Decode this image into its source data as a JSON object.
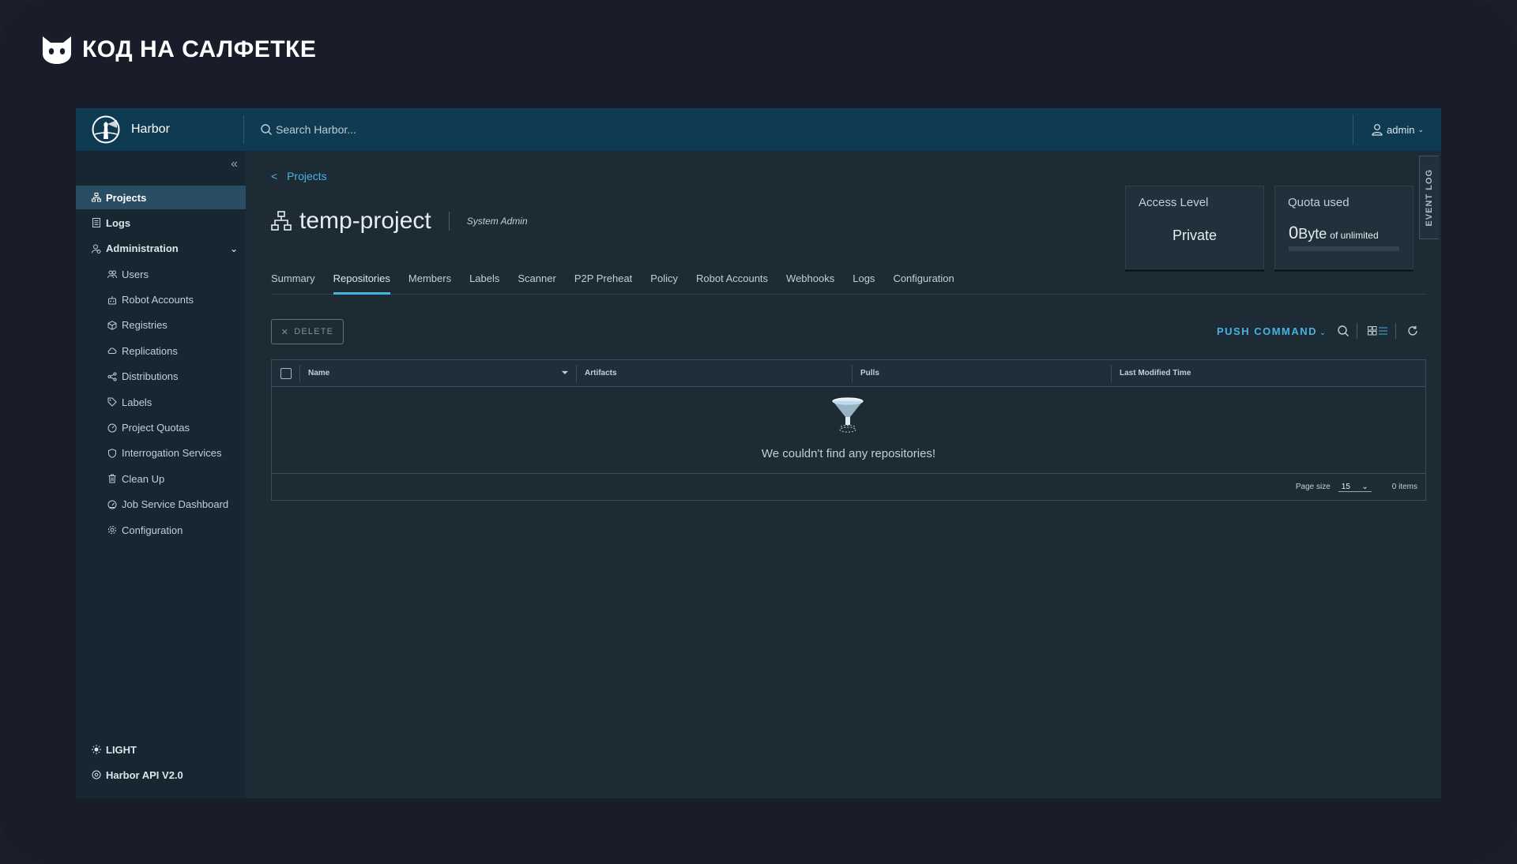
{
  "brand": {
    "text": "КОД НА САЛФЕТКЕ"
  },
  "header": {
    "app_name": "Harbor",
    "search_placeholder": "Search Harbor...",
    "user": "admin"
  },
  "sidebar": {
    "items": [
      {
        "label": "Projects",
        "icon": "projects-icon"
      },
      {
        "label": "Logs",
        "icon": "logs-icon"
      },
      {
        "label": "Administration",
        "icon": "administration-icon"
      }
    ],
    "admin_items": [
      {
        "label": "Users"
      },
      {
        "label": "Robot Accounts"
      },
      {
        "label": "Registries"
      },
      {
        "label": "Replications"
      },
      {
        "label": "Distributions"
      },
      {
        "label": "Labels"
      },
      {
        "label": "Project Quotas"
      },
      {
        "label": "Interrogation Services"
      },
      {
        "label": "Clean Up"
      },
      {
        "label": "Job Service Dashboard"
      },
      {
        "label": "Configuration"
      }
    ],
    "theme_toggle": "LIGHT",
    "api_link": "Harbor API V2.0"
  },
  "main": {
    "breadcrumb": "Projects",
    "title": "temp-project",
    "role": "System Admin",
    "access_card": {
      "title": "Access Level",
      "value": "Private"
    },
    "quota_card": {
      "title": "Quota used",
      "amount": "0",
      "unit": "Byte",
      "limit": "of unlimited",
      "usage_fraction": 0
    },
    "event_log": "EVENT LOG",
    "tabs": [
      "Summary",
      "Repositories",
      "Members",
      "Labels",
      "Scanner",
      "P2P Preheat",
      "Policy",
      "Robot Accounts",
      "Webhooks",
      "Logs",
      "Configuration"
    ],
    "active_tab": "Repositories",
    "delete_label": "DELETE",
    "push_command": "PUSH COMMAND",
    "columns": [
      "Name",
      "Artifacts",
      "Pulls",
      "Last Modified Time"
    ],
    "empty_message": "We couldn't find any repositories!",
    "page_size_label": "Page size",
    "page_size": "15",
    "items_count": "0 items"
  },
  "colors": {
    "accent": "#48b2e3",
    "header_bg": "#0e3a52",
    "sidebar_bg": "#172731",
    "content_bg": "#1d2b35"
  }
}
